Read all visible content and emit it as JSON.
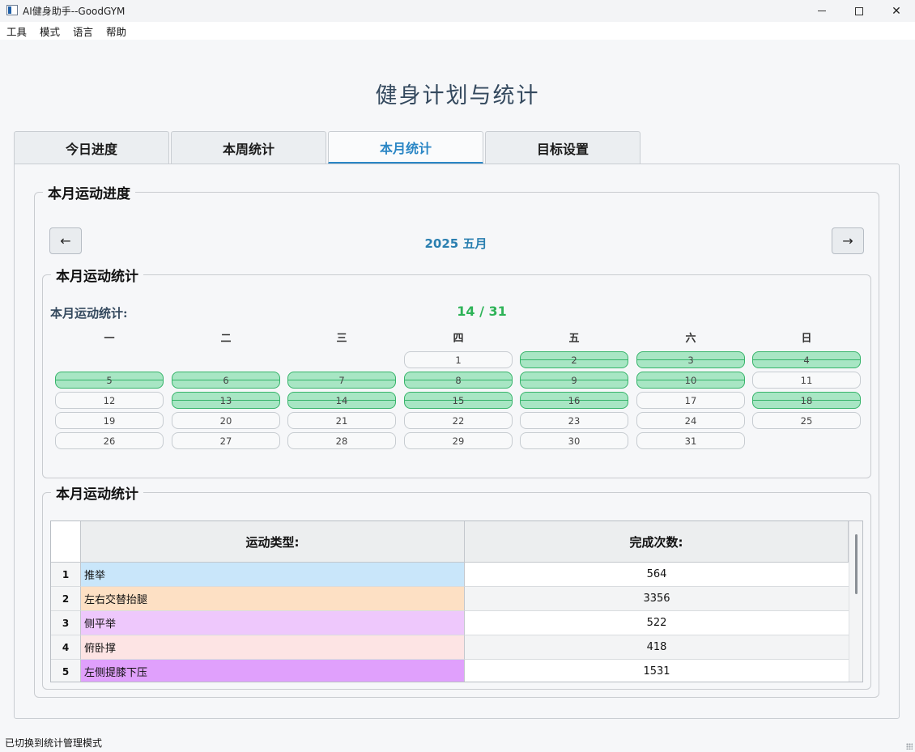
{
  "window": {
    "title": "AI健身助手--GoodGYM"
  },
  "menu": [
    "工具",
    "模式",
    "语言",
    "帮助"
  ],
  "page_title": "健身计划与统计",
  "tabs": [
    {
      "label": "今日进度",
      "active": false
    },
    {
      "label": "本周统计",
      "active": false
    },
    {
      "label": "本月统计",
      "active": true
    },
    {
      "label": "目标设置",
      "active": false
    }
  ],
  "progress_group": {
    "title": "本月运动进度",
    "prev_label": "←",
    "next_label": "→",
    "month_label": "2025 五月"
  },
  "calendar_group": {
    "title": "本月运动统计",
    "stat_label": "本月运动统计:",
    "stat_value": "14 / 31",
    "weekdays": [
      "一",
      "二",
      "三",
      "四",
      "五",
      "六",
      "日"
    ],
    "days": [
      {
        "day": "1",
        "done": false
      },
      {
        "day": "2",
        "done": true
      },
      {
        "day": "3",
        "done": true
      },
      {
        "day": "4",
        "done": true
      },
      {
        "day": "5",
        "done": true
      },
      {
        "day": "6",
        "done": true
      },
      {
        "day": "7",
        "done": true
      },
      {
        "day": "8",
        "done": true
      },
      {
        "day": "9",
        "done": true
      },
      {
        "day": "10",
        "done": true
      },
      {
        "day": "11",
        "done": false
      },
      {
        "day": "12",
        "done": false
      },
      {
        "day": "13",
        "done": true
      },
      {
        "day": "14",
        "done": true
      },
      {
        "day": "15",
        "done": true
      },
      {
        "day": "16",
        "done": true
      },
      {
        "day": "17",
        "done": false
      },
      {
        "day": "18",
        "done": true
      },
      {
        "day": "19",
        "done": false
      },
      {
        "day": "20",
        "done": false
      },
      {
        "day": "21",
        "done": false
      },
      {
        "day": "22",
        "done": false
      },
      {
        "day": "23",
        "done": false
      },
      {
        "day": "24",
        "done": false
      },
      {
        "day": "25",
        "done": false
      },
      {
        "day": "26",
        "done": false
      },
      {
        "day": "27",
        "done": false
      },
      {
        "day": "28",
        "done": false
      },
      {
        "day": "29",
        "done": false
      },
      {
        "day": "30",
        "done": false
      },
      {
        "day": "31",
        "done": false
      }
    ],
    "colors": {
      "done_fill": "#a8e6c4",
      "done_border": "#36b46a"
    }
  },
  "table_group": {
    "title": "本月运动统计",
    "headers": [
      "运动类型:",
      "完成次数:"
    ],
    "rows": [
      {
        "num": "1",
        "type": "推举",
        "count": "564",
        "color": "#c9e6fa"
      },
      {
        "num": "2",
        "type": "左右交替抬腿",
        "count": "3356",
        "color": "#fde0c4"
      },
      {
        "num": "3",
        "type": "侧平举",
        "count": "522",
        "color": "#eec8fc"
      },
      {
        "num": "4",
        "type": "俯卧撑",
        "count": "418",
        "color": "#fde4e4"
      },
      {
        "num": "5",
        "type": "左侧提膝下压",
        "count": "1531",
        "color": "#e0a0fc"
      }
    ]
  },
  "status": "已切换到统计管理模式",
  "colors": {
    "accent": "#2a86c5",
    "stat_green": "#2eb358",
    "title_color": "#34495e"
  }
}
